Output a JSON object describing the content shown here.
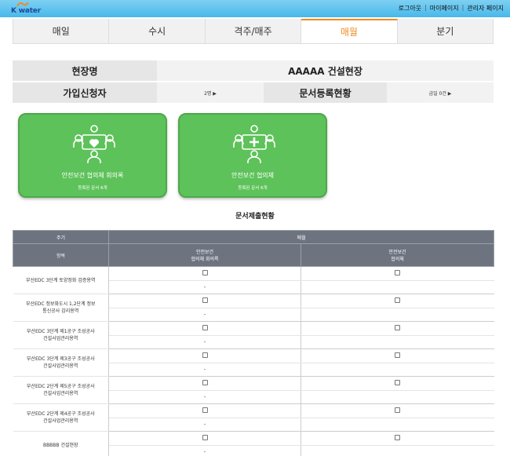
{
  "header": {
    "logo_text": "K water",
    "links": [
      "로그아웃",
      "마이페이지",
      "관리자 페이지"
    ]
  },
  "tabs": [
    {
      "label": "매일",
      "active": false
    },
    {
      "label": "수시",
      "active": false
    },
    {
      "label": "격주/매주",
      "active": false
    },
    {
      "label": "매월",
      "active": true
    },
    {
      "label": "분기",
      "active": false
    }
  ],
  "info": {
    "site_label": "현장명",
    "site_value": "AAAAA 건설현장",
    "applicant_label": "가입신청자",
    "applicant_value": "2명 ▶",
    "docs_label": "문서등록현황",
    "docs_value": "금일 0건 ▶"
  },
  "cards": [
    {
      "title": "안전보건 협의체 회의록",
      "sub": "등록된 문서 6개",
      "icon": "meeting-heart-icon"
    },
    {
      "title": "안전보건 협의체",
      "sub": "등록된 문서 6개",
      "icon": "meeting-cross-icon"
    }
  ],
  "section_title": "문서제출현황",
  "table": {
    "h_period": "주기",
    "h_monthly": "매월",
    "h_item": "항목",
    "col1_line1": "안전보건",
    "col1_line2": "협의체 회의록",
    "col2_line1": "안전보건",
    "col2_line2": "협의체",
    "rows": [
      {
        "name": "부산EDC 3단계 토양정화 검증용역"
      },
      {
        "name": "부산EDC 정보화도시 1,2단계 정보통신공사 감리용역"
      },
      {
        "name": "부산EDC 3단계 제1공구 조성공사 건설사업관리용역"
      },
      {
        "name": "부산EDC 3단계 제3공구 조성공사 건설사업관리용역"
      },
      {
        "name": "부산EDC 2단계 제5공구 조성공사 건설사업관리용역"
      },
      {
        "name": "부산EDC 2단계 제4공구 조성공사 건설사업관리용역"
      },
      {
        "name": "BBBBB 건설현장"
      }
    ],
    "dash": "-"
  },
  "colors": {
    "topbar": "#47b8ea",
    "active_tab": "#f08a1f",
    "card_green": "#5ec25a",
    "table_header": "#6d7480"
  }
}
